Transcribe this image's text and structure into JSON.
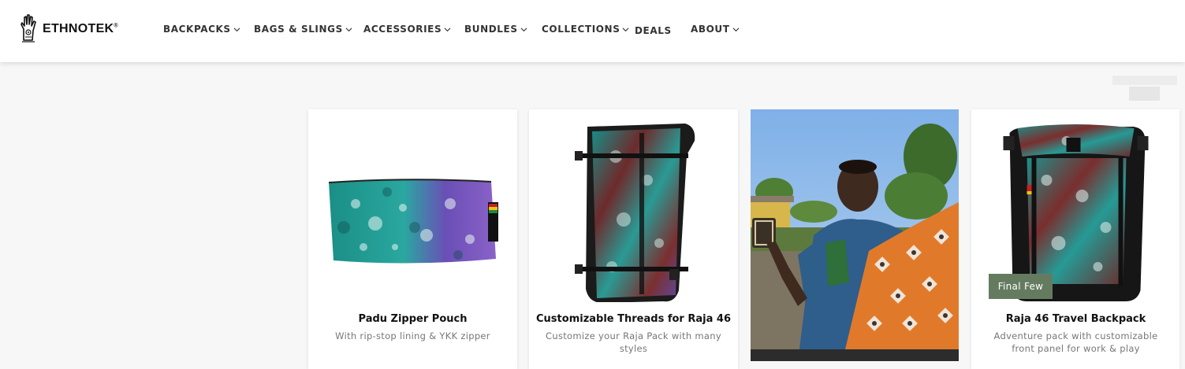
{
  "brand": {
    "name": "ETHNOTEK",
    "registered": "®"
  },
  "nav": [
    {
      "label": "BACKPACKS",
      "has_dropdown": true
    },
    {
      "label": "BAGS & SLINGS",
      "has_dropdown": true
    },
    {
      "label": "ACCESSORIES",
      "has_dropdown": true
    },
    {
      "label": "BUNDLES",
      "has_dropdown": true
    },
    {
      "label": "COLLECTIONS",
      "has_dropdown": true
    },
    {
      "label": "DEALS",
      "has_dropdown": false
    },
    {
      "label": "ABOUT",
      "has_dropdown": true
    }
  ],
  "products": [
    {
      "title": "Padu Zipper Pouch",
      "subtitle": "With rip-stop lining & YKK zipper"
    },
    {
      "title": "Customizable Threads for Raja 46",
      "subtitle": "Customize your Raja Pack with many styles"
    },
    {
      "title": "Raja 46 Travel Backpack",
      "subtitle": "Adventure pack with customizable front panel for work & play",
      "badge": "Final Few"
    }
  ],
  "colors": {
    "badge_bg": "#657b60",
    "teal": "#1d8d8a",
    "purple": "#7a54b4",
    "maroon": "#7a2e2e"
  },
  "icons": {
    "logo": "hand-logo-icon",
    "dropdown": "chevron-down-icon"
  }
}
